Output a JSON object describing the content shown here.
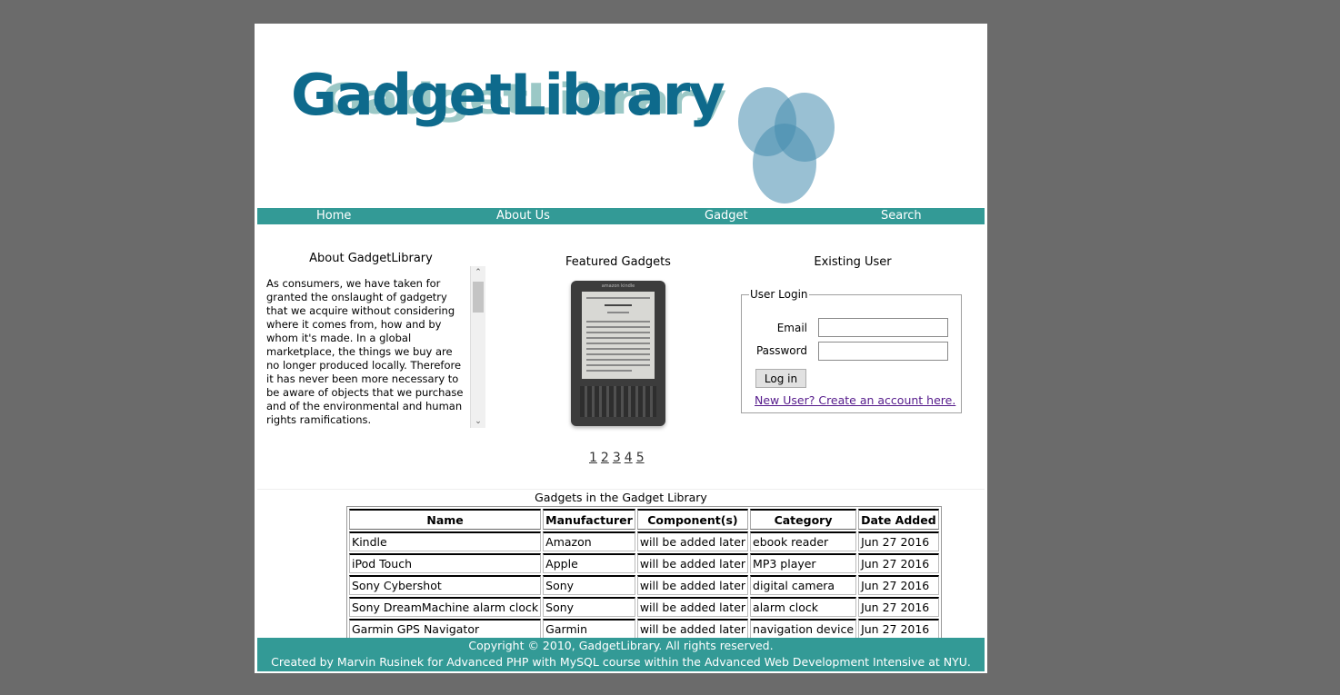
{
  "logo": {
    "text": "GadgetLibrary"
  },
  "nav": {
    "items": [
      {
        "label": "Home"
      },
      {
        "label": "About Us"
      },
      {
        "label": "Gadget"
      },
      {
        "label": "Search"
      }
    ]
  },
  "about": {
    "title": "About GadgetLibrary",
    "text": "As consumers, we have taken for granted the onslaught of gadgetry that we acquire without considering where it comes from, how and by whom it's made. In a global marketplace, the things we buy are no longer produced locally. Therefore it has never been more necessary to be aware of objects that we purchase and of the environmental and human rights ramifications."
  },
  "featured": {
    "title": "Featured Gadgets",
    "image_icon": "kindle-ereader-image",
    "pages": [
      "1",
      "2",
      "3",
      "4",
      "5"
    ]
  },
  "login": {
    "section_title": "Existing User",
    "legend": "User Login",
    "email_label": "Email",
    "email_value": "",
    "password_label": "Password",
    "password_value": "",
    "button_label": "Log in",
    "new_user_link": "New User? Create an account here."
  },
  "table": {
    "caption": "Gadgets in the Gadget Library",
    "headers": [
      "Name",
      "Manufacturer",
      "Component(s)",
      "Category",
      "Date Added"
    ],
    "rows": [
      [
        "Kindle",
        "Amazon",
        "will be added later",
        "ebook reader",
        "Jun 27 2016"
      ],
      [
        "iPod Touch",
        "Apple",
        "will be added later",
        "MP3 player",
        "Jun 27 2016"
      ],
      [
        "Sony Cybershot",
        "Sony",
        "will be added later",
        "digital camera",
        "Jun 27 2016"
      ],
      [
        "Sony DreamMachine alarm clock",
        "Sony",
        "will be added later",
        "alarm clock",
        "Jun 27 2016"
      ],
      [
        "Garmin GPS Navigator",
        "Garmin",
        "will be added later",
        "navigation device",
        "Jun 27 2016"
      ]
    ]
  },
  "footer": {
    "line1": "Copyright © 2010, GadgetLibrary. All rights reserved.",
    "line2": "Created by Marvin Rusinek for Advanced PHP with MySQL course within the Advanced Web Development Intensive at NYU."
  },
  "colors": {
    "accent": "#339a96",
    "logo_blue": "#0e6a8c",
    "page_bg": "#6b6b6b"
  }
}
